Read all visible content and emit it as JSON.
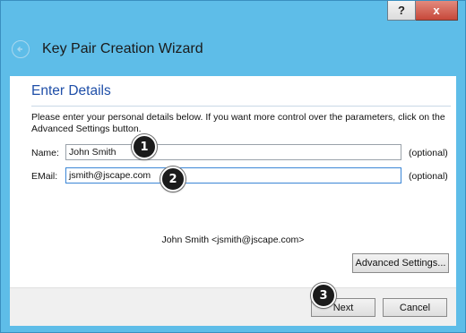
{
  "window": {
    "help_label": "?",
    "close_label": "x",
    "title": "Key Pair Creation Wizard"
  },
  "page": {
    "section_title": "Enter Details",
    "intro": "Please enter your personal details below. If you want more control over the parameters, click on the Advanced Settings button."
  },
  "fields": {
    "name": {
      "label": "Name:",
      "value": "John Smith",
      "hint": "(optional)"
    },
    "email": {
      "label": "EMail:",
      "value": "jsmith@jscape.com",
      "hint": "(optional)"
    }
  },
  "preview": "John Smith <jsmith@jscape.com>",
  "buttons": {
    "advanced": "Advanced Settings...",
    "next": "Next",
    "cancel": "Cancel"
  },
  "annotations": {
    "step1": "1",
    "step2": "2",
    "step3": "3"
  }
}
